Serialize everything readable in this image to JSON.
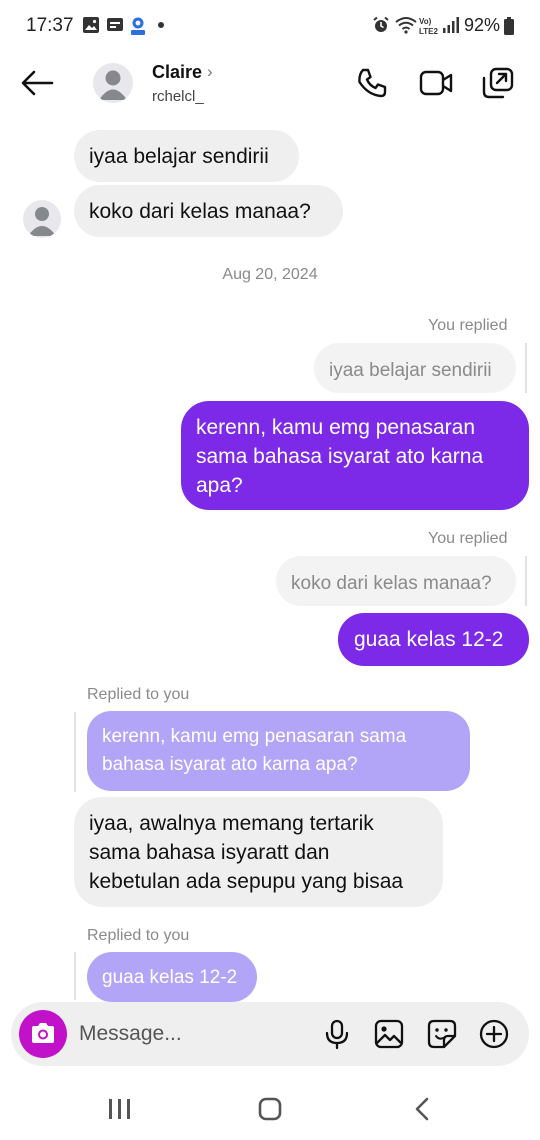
{
  "status_bar": {
    "time": "17:37",
    "battery": "92%",
    "icons": [
      "gallery-icon",
      "notification-icon",
      "app-icon",
      "dot-icon",
      "alarm-icon",
      "wifi-icon",
      "volte-icon",
      "signal-icon",
      "battery-icon"
    ]
  },
  "header": {
    "name": "Claire",
    "chevron": "›",
    "handle": "rchelcl_",
    "icons": [
      "back-arrow-icon",
      "avatar-icon",
      "phone-icon",
      "video-icon",
      "external-link-icon"
    ]
  },
  "chat": {
    "received_top": [
      {
        "text": "iyaa belajar sendirii"
      },
      {
        "text": "koko dari kelas manaa?"
      }
    ],
    "date_separator": "Aug 20, 2024",
    "reply_1": {
      "label": "You replied",
      "quoted": "iyaa belajar sendirii",
      "message_lines": [
        "kerenn, kamu emg penasaran",
        "sama bahasa isyarat ato karna",
        "apa?"
      ]
    },
    "reply_2": {
      "label": "You replied",
      "quoted": "koko dari kelas manaa?",
      "message": "guaa kelas 12-2"
    },
    "incoming_reply_1": {
      "label": "Replied to you",
      "quoted_lines": [
        "kerenn, kamu emg penasaran sama",
        "bahasa isyarat ato karna apa?"
      ],
      "message_lines": [
        "iyaa, awalnya memang tertarik",
        "sama bahasa isyaratt dan",
        "kebetulan ada sepupu yang bisaa"
      ]
    },
    "incoming_reply_2": {
      "label": "Replied to you",
      "quoted": "guaa kelas 12-2"
    }
  },
  "composer": {
    "placeholder": "Message...",
    "icons": [
      "camera-icon",
      "microphone-icon",
      "image-icon",
      "sticker-icon",
      "plus-icon"
    ]
  },
  "colors": {
    "sent_bubble": "#7d2ae8",
    "quoted_incoming": "#b2a4f7",
    "received_bubble": "#efefef",
    "camera_button": "#c112c9"
  },
  "nav_bar": {
    "icons": [
      "recents-icon",
      "home-icon",
      "back-icon"
    ]
  }
}
